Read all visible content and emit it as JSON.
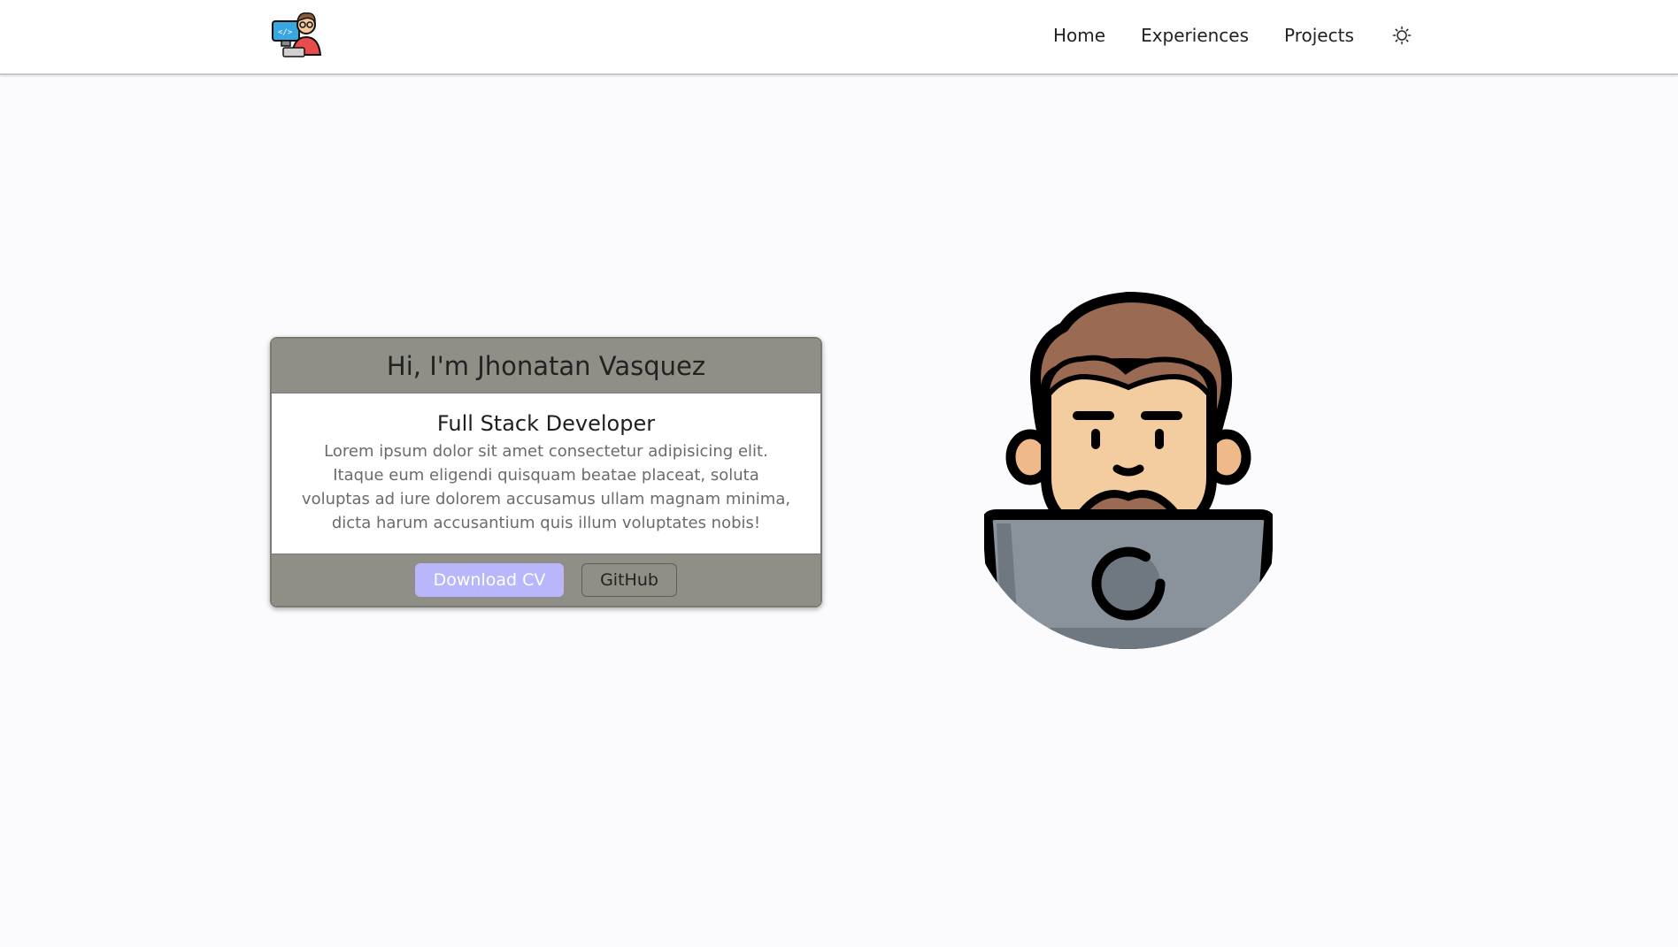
{
  "nav": {
    "logo_icon": "developer-logo-icon",
    "links": [
      {
        "label": "Home"
      },
      {
        "label": "Experiences"
      },
      {
        "label": "Projects"
      }
    ],
    "theme_icon": "sun-icon"
  },
  "hero": {
    "card": {
      "title": "Hi, I'm Jhonatan Vasquez",
      "subtitle": "Full Stack Developer",
      "description": "Lorem ipsum dolor sit amet consectetur adipisicing elit. Itaque eum eligendi quisquam beatae placeat, soluta voluptas ad iure dolorem accusamus ullam magnam minima, dicta harum accusantium quis illum voluptates nobis!",
      "primary_button": "Download CV",
      "secondary_button": "GitHub"
    },
    "avatar_icon": "developer-avatar-illustration"
  },
  "colors": {
    "background": "#fbfafd",
    "card_header": "#8f8e87",
    "primary_button": "#b9b6fb"
  }
}
